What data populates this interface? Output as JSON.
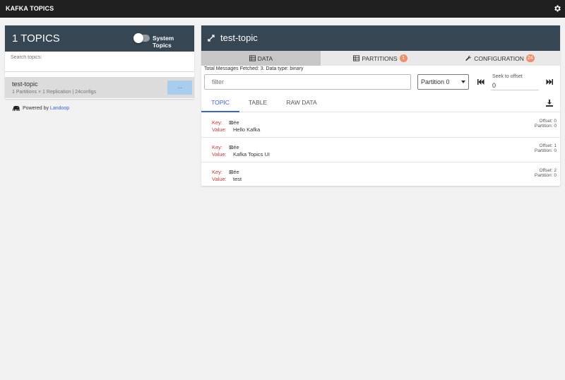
{
  "app": {
    "title": "KAFKA TOPICS",
    "settings_icon": "gear-icon"
  },
  "left": {
    "header_title": "1 TOPICS",
    "system_topics_label": "System Topics",
    "system_topics_enabled": false,
    "search_placeholder": "Search topics:",
    "topics": [
      {
        "name": "test-topic",
        "meta": "1 Partitions × 1 Replication | 24configs",
        "button_label": "..."
      }
    ],
    "powered_prefix": "Powered by ",
    "powered_link": "Landoop"
  },
  "right": {
    "title": "test-topic",
    "tabs": [
      {
        "label": "DATA",
        "icon": "table-icon",
        "badge": ""
      },
      {
        "label": "PARTITIONS",
        "icon": "table-icon",
        "badge": "1"
      },
      {
        "label": "CONFIGURATION",
        "icon": "wrench-icon",
        "badge": "24"
      }
    ],
    "info": "Total Messages Fetched: 3. Data type: binary",
    "filter_placeholder": "filter",
    "partition_selected": "Partition 0",
    "seek_label": "Seek to offset",
    "seek_value": "0",
    "subtabs": [
      "TOPIC",
      "TABLE",
      "RAW DATA"
    ],
    "messages": [
      {
        "key_label": "Key:",
        "key": "⊠ée",
        "value_label": "Value:",
        "value": "Hello Kafka",
        "offset": "Offset: 0",
        "partition": "Partition: 0"
      },
      {
        "key_label": "Key:",
        "key": "⊠ée",
        "value_label": "Value:",
        "value": "Kafka Topics UI",
        "offset": "Offset: 1",
        "partition": "Partition: 0"
      },
      {
        "key_label": "Key:",
        "key": "⊠ée",
        "value_label": "Value:",
        "value": "test",
        "offset": "Offset: 2",
        "partition": "Partition: 0"
      }
    ]
  },
  "colors": {
    "header": "#364652",
    "topbar": "#1f1f1f",
    "accent": "#3b62d6",
    "badge": "#ef8f6c",
    "key_red": "#cc3b3b"
  }
}
